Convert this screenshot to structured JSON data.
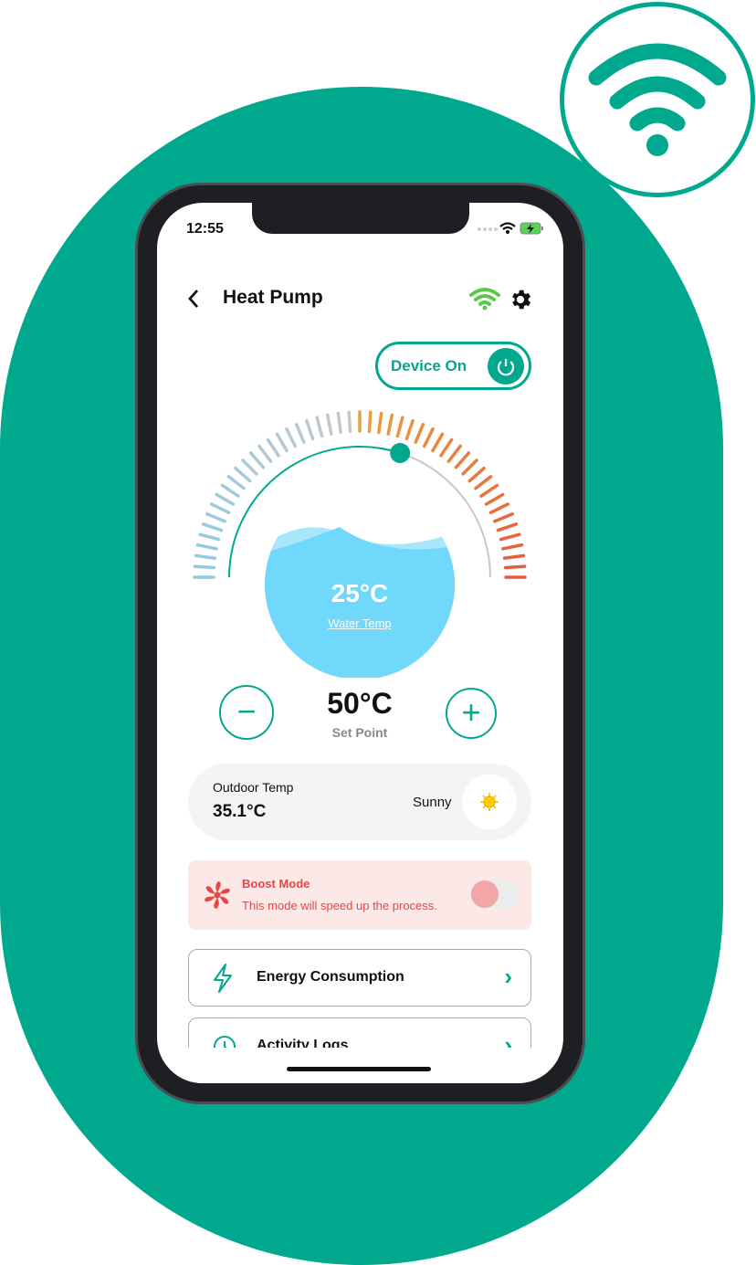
{
  "status_bar": {
    "time": "12:55"
  },
  "header": {
    "title": "Heat Pump",
    "back_icon": "chevron-left-icon",
    "wifi_icon": "wifi-icon",
    "settings_icon": "gear-icon"
  },
  "device": {
    "label": "Device On",
    "state": true
  },
  "gauge": {
    "water_temp": "25°C",
    "water_label": "Water Temp",
    "set_point": "50°C",
    "set_point_label": "Set Point",
    "set_point_fraction": 0.6,
    "colors": {
      "cold": "#8ecae6",
      "hot": "#e8583a",
      "accent": "#00a88e"
    }
  },
  "outdoor": {
    "label": "Outdoor Temp",
    "value": "35.1°C",
    "condition": "Sunny"
  },
  "boost": {
    "title": "Boost Mode",
    "description": "This mode will speed up the process.",
    "enabled": false
  },
  "menu": [
    {
      "label": "Energy Consumption",
      "icon": "lightning-icon"
    },
    {
      "label": "Activity Logs",
      "icon": "history-icon"
    }
  ],
  "colors": {
    "brand": "#00a88e",
    "boost": "#e84545"
  }
}
